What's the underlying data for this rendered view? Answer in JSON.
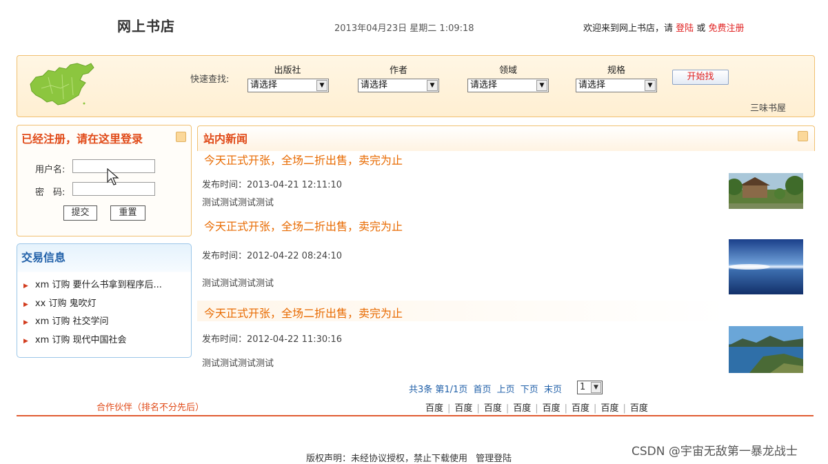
{
  "header": {
    "site_title": "网上书店",
    "datetime": "2013年04月23日 星期二 1:09:18",
    "welcome_text": "欢迎来到网上书店，请",
    "login_link": "登陆",
    "or_text": "或",
    "register_link": "免费注册"
  },
  "search": {
    "label": "快速查找:",
    "filters": [
      {
        "label": "出版社",
        "value": "请选择"
      },
      {
        "label": "作者",
        "value": "请选择"
      },
      {
        "label": "领域",
        "value": "请选择"
      },
      {
        "label": "规格",
        "value": "请选择"
      }
    ],
    "button": "开始找",
    "store_name": "三味书屋"
  },
  "login": {
    "title": "已经注册，请在这里登录",
    "username_label": "用户名:",
    "password_label": "密　码:",
    "submit": "提交",
    "reset": "重置"
  },
  "trade": {
    "title": "交易信息",
    "items": [
      "xm 订购 要什么书拿到程序后...",
      "xx 订购 鬼吹灯",
      "xm 订购 社交学问",
      "xm 订购 现代中国社会"
    ]
  },
  "news": {
    "title": "站内新闻",
    "items": [
      {
        "headline": "今天正式开张，全场二折出售，卖完为止",
        "time": "发布时间：2013-04-21 12:11:10",
        "body": "测试测试测试测试",
        "thumb": "village"
      },
      {
        "headline": "今天正式开张，全场二折出售，卖完为止",
        "time": "发布时间：2012-04-22 08:24:10",
        "body": "测试测试测试测试",
        "thumb": "ocean-sky"
      },
      {
        "headline": "今天正式开张，全场二折出售，卖完为止",
        "time": "发布时间：2012-04-22 11:30:16",
        "body": "测试测试测试测试",
        "thumb": "coast"
      }
    ]
  },
  "pager": {
    "summary": "共3条 第1/1页",
    "first": "首页",
    "prev": "上页",
    "next": "下页",
    "last": "末页",
    "current": "1"
  },
  "partners": {
    "label": "合作伙伴（排名不分先后）",
    "links": [
      "百度",
      "百度",
      "百度",
      "百度",
      "百度",
      "百度",
      "百度",
      "百度"
    ]
  },
  "footer": {
    "copyright": "版权声明：未经协议授权，禁止下载使用",
    "admin_link": "管理登陆",
    "watermark": "CSDN @宇宙无敌第一暴龙战士"
  },
  "colors": {
    "accent_red": "#e02020",
    "headline_orange": "#e86a00",
    "link_blue": "#1f5fa8"
  }
}
